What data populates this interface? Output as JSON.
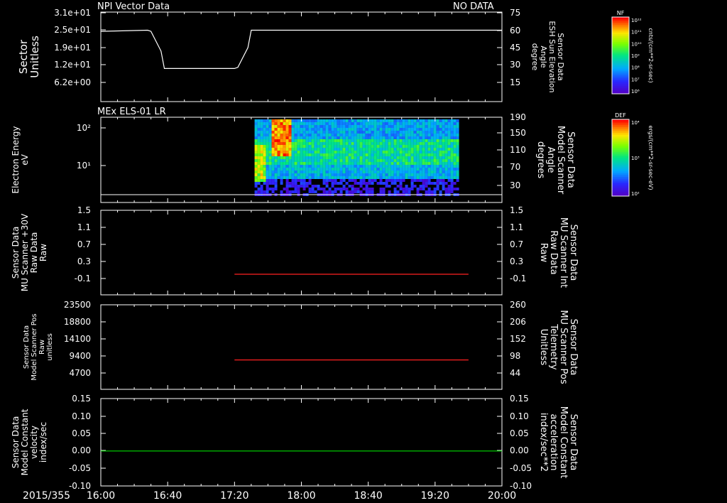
{
  "header": {
    "date": "2015/355",
    "time_ticks": [
      "16:00",
      "16:40",
      "17:20",
      "18:00",
      "18:40",
      "19:20",
      "20:00"
    ]
  },
  "colors": {
    "background": "#000000",
    "axes": "#ffffff",
    "red_trace": "#ff2020",
    "green_trace": "#00dd00"
  },
  "chart_data": [
    {
      "type": "line",
      "panel_title": "NPI Vector Data",
      "status": "NO DATA",
      "ylabel": [
        "Sector",
        "Unitless"
      ],
      "yticks": [
        "3.1e+01",
        "2.5e+01",
        "1.9e+01",
        "1.2e+01",
        "6.2e+00"
      ],
      "y2label": [
        "Sensor Data",
        "ESH Sun Elevation",
        "Angle",
        "degree"
      ],
      "y2ticks": [
        "75",
        "60",
        "45",
        "30",
        "15"
      ],
      "y2lim": [
        0,
        75
      ],
      "series": [
        {
          "x": [
            "16:00",
            "16:28",
            "16:30",
            "16:36",
            "16:38",
            "17:20",
            "17:22",
            "17:28",
            "17:30",
            "20:00"
          ],
          "values": [
            59,
            60,
            59,
            42,
            27,
            27,
            28,
            45,
            60,
            60
          ]
        }
      ]
    },
    {
      "type": "heatmap",
      "panel_title": "MEx ELS-01 LR",
      "ylabel": [
        "Electron Energy",
        "eV"
      ],
      "yticks": [
        "10²",
        "10¹"
      ],
      "y_scale": "log",
      "y2label": [
        "Sensor Data",
        "Model Scanner",
        "Angle",
        "degrees"
      ],
      "y2ticks": [
        "190",
        "150",
        "110",
        "70",
        "30"
      ],
      "data_span": [
        "17:32",
        "19:34"
      ],
      "colorbar_label": "DEF",
      "colorbar_ticks": [
        "10⁴",
        "10³",
        "10²"
      ],
      "colorbar_units": "ergs/(cm**2-sr-sec-eV)"
    },
    {
      "type": "line",
      "ylabel": [
        "Sensor Data",
        "MU Scanner +30V",
        "Raw Data",
        "Raw"
      ],
      "yticks": [
        "1.5",
        "1.1",
        "0.7",
        "0.3",
        "-0.1"
      ],
      "y2label": [
        "Sensor Data",
        "MU Scanner Int",
        "Raw Data",
        "Raw"
      ],
      "y2ticks": [
        "1.5",
        "1.1",
        "0.7",
        "0.3",
        "-0.1"
      ],
      "ylim": [
        -0.5,
        1.5
      ],
      "series": [
        {
          "x": [
            "17:20",
            "19:40"
          ],
          "values": [
            0.0,
            0.0
          ]
        }
      ]
    },
    {
      "type": "line",
      "ylabel": [
        "Sensor Data",
        "Model Scanner Pos",
        "Raw",
        "unitless"
      ],
      "yticks": [
        "23500",
        "18800",
        "14100",
        "9400",
        "4700"
      ],
      "y2label": [
        "Sensor Data",
        "MU Scanner Pos",
        "Telemetry",
        "Unitless"
      ],
      "y2ticks": [
        "260",
        "206",
        "152",
        "98",
        "44"
      ],
      "ylim": [
        0,
        23500
      ],
      "series": [
        {
          "x": [
            "17:20",
            "19:40"
          ],
          "values": [
            8300,
            8300
          ]
        }
      ]
    },
    {
      "type": "line",
      "ylabel": [
        "Sensor Data",
        "Model Constant",
        "velocity",
        "index/sec"
      ],
      "yticks": [
        "0.15",
        "0.10",
        "0.05",
        "0.00",
        "-0.05",
        "-0.10"
      ],
      "y2label": [
        "Sensor Data",
        "Model Constant",
        "acceleration",
        "index/sec**2"
      ],
      "y2ticks": [
        "0.15",
        "0.10",
        "0.05",
        "0.00",
        "-0.05",
        "-0.10"
      ],
      "ylim": [
        -0.1,
        0.15
      ],
      "series": [
        {
          "x": [
            "16:00",
            "20:00"
          ],
          "values": [
            0.0,
            0.0
          ]
        }
      ]
    }
  ],
  "colorbars": [
    {
      "label": "NF",
      "ticks": [
        "10¹²",
        "10¹¹",
        "10¹⁰",
        "10⁹",
        "10⁸",
        "10⁷",
        "10⁶"
      ],
      "units": "cnts/(cm**2-sr-sec)"
    }
  ]
}
